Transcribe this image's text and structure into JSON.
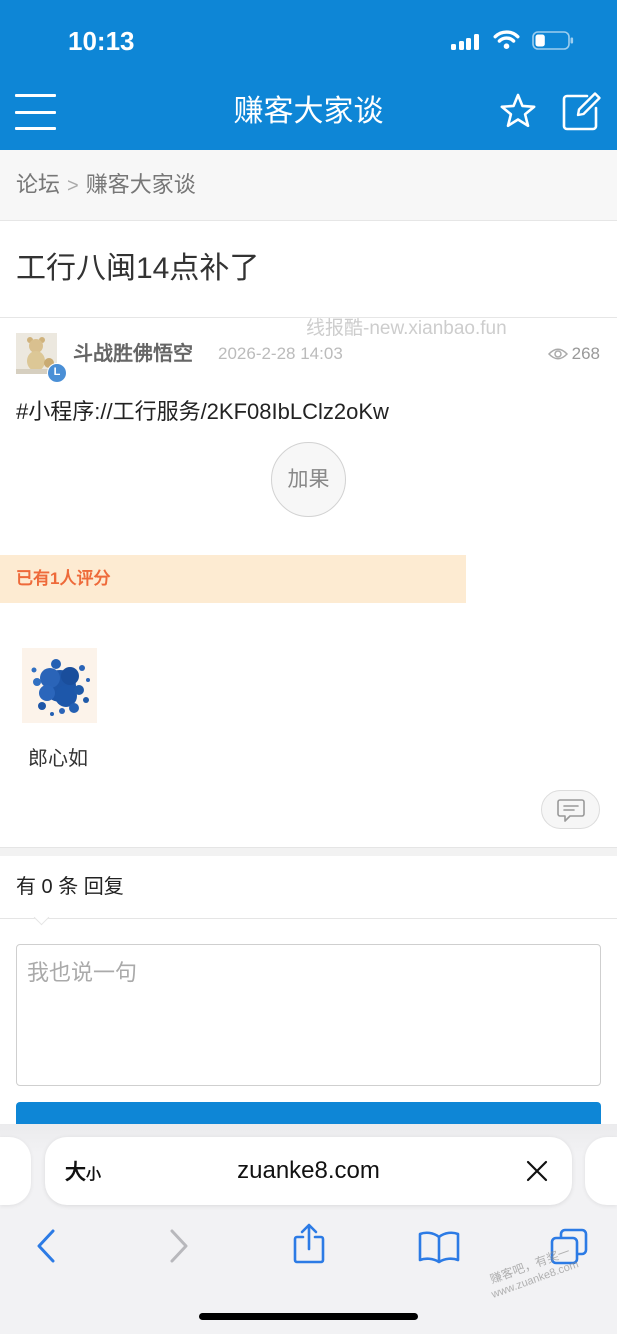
{
  "status_bar": {
    "time": "10:13",
    "battery_level": 0.3
  },
  "header": {
    "title": "赚客大家谈"
  },
  "breadcrumb": {
    "root": "论坛",
    "separator": ">",
    "current": "赚客大家谈"
  },
  "thread": {
    "title": "工行八闽14点补了"
  },
  "post": {
    "author": "斗战胜佛悟空",
    "author_badge": "L",
    "date": "2026-2-28 14:03",
    "views": "268",
    "content": "#小程序://工行服务/2KF08IbLClz2oKw",
    "add_button": "加果"
  },
  "rating": {
    "summary": "已有1人评分",
    "raters": [
      {
        "name": "郎心如"
      }
    ]
  },
  "replies": {
    "count_label": "有 0 条 回复",
    "input_placeholder": "我也说一句"
  },
  "browser": {
    "text_size": {
      "big": "大",
      "small": "小"
    },
    "url": "zuanke8.com"
  },
  "watermarks": {
    "site": "线报酷-new.xianbao.fun",
    "footer_line1": "赚客吧，有奖一",
    "footer_line2": "www.zuanke8.com"
  },
  "colors": {
    "header_bg": "#0e86d6",
    "accent_button": "#0e86d6",
    "rating_bg": "#fdebd2",
    "rating_text": "#ee6a3a",
    "safari_blue": "#2c7be5",
    "badge_blue": "#4a8fd6"
  },
  "icons": {
    "menu": "menu-icon",
    "favorite": "star-icon",
    "compose": "edit-icon",
    "views": "eye-icon",
    "comment": "comment-icon",
    "close": "close-icon",
    "back": "chevron-left-icon",
    "forward": "chevron-right-icon",
    "share": "share-icon",
    "bookmarks": "book-icon",
    "tabs": "tabs-icon"
  }
}
